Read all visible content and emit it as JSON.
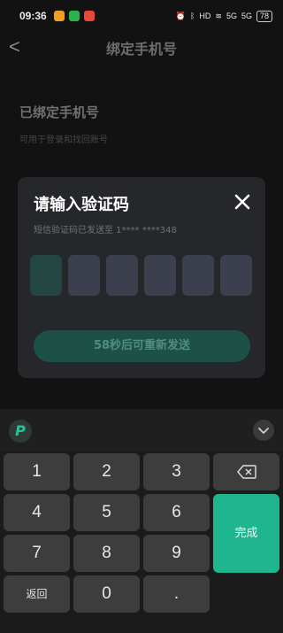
{
  "status_bar": {
    "time": "09:36",
    "battery": "78",
    "network_labels": [
      "HD",
      "5G",
      "5G"
    ]
  },
  "page": {
    "back_glyph": "<",
    "title": "绑定手机号",
    "bound_title": "已绑定手机号",
    "bound_subtitle": "可用于登录和找回账号"
  },
  "dialog": {
    "title": "请输入验证码",
    "sent_text": "短信验证码已发送至 1**** ****348",
    "code_length": 6,
    "filled": 0,
    "resend_label": "58秒后可重新发送"
  },
  "keyboard": {
    "keys": [
      "1",
      "2",
      "3",
      "4",
      "5",
      "6",
      "7",
      "8",
      "9",
      "0",
      "."
    ],
    "back_label": "返回",
    "done_label": "完成",
    "logo_glyph": "P"
  },
  "colors": {
    "accent": "#1fb58f",
    "dialog_bg": "#26272b",
    "code_box": "#3b3f4e",
    "code_box_active": "#234643"
  }
}
